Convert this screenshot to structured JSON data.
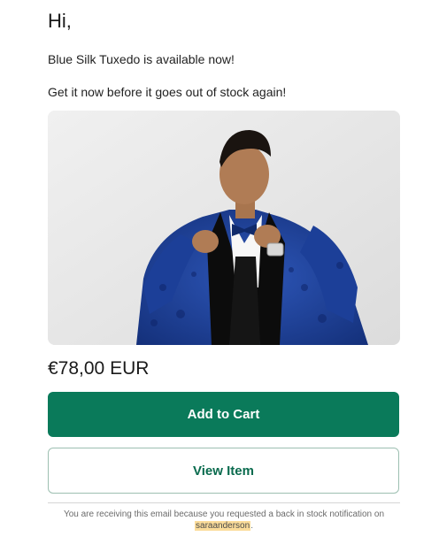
{
  "email": {
    "greeting": "Hi,",
    "availability_text": "Blue Silk Tuxedo is available now!",
    "urgency_text": "Get it now before it goes out of stock again!",
    "product": {
      "image_subject": "man-in-blue-tuxedo-photo",
      "price": "€78,00 EUR"
    },
    "buttons": {
      "add_to_cart": "Add to Cart",
      "view_item": "View Item"
    },
    "footer": {
      "notice": "You are receiving this email because you requested a back in stock notification on",
      "username": "saraanderson",
      "period": "."
    },
    "colors": {
      "primary": "#0a7a5a",
      "primary_text": "#0a6b4e",
      "highlight": "#fbdc9a"
    }
  }
}
